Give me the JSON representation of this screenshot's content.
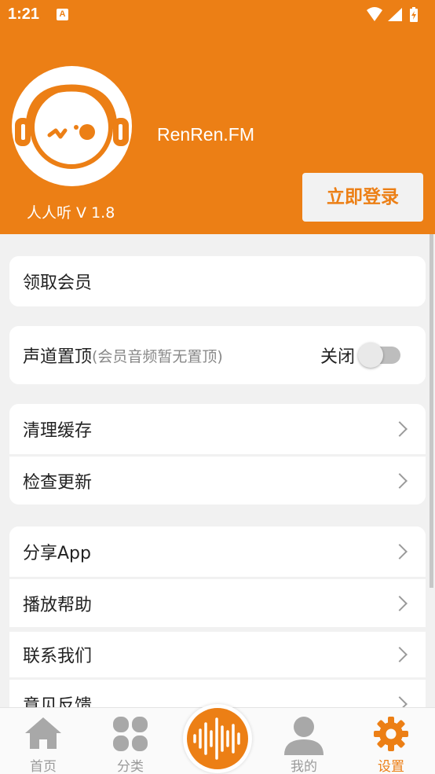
{
  "status": {
    "time": "1:21",
    "notif": "A"
  },
  "header": {
    "app_name": "RenRen.FM",
    "version": "人人听 V 1.8",
    "login_label": "立即登录"
  },
  "settings": {
    "vip": "领取会员",
    "channel_top": "声道置顶",
    "channel_note": "(会员音频暂无置顶)",
    "toggle_state": "关闭",
    "toggle_on": false,
    "clear_cache": "清理缓存",
    "check_update": "检查更新",
    "share_app": "分享App",
    "play_help": "播放帮助",
    "contact_us": "联系我们",
    "feedback": "意见反馈"
  },
  "nav": {
    "home": "首页",
    "category": "分类",
    "mine": "我的",
    "settings": "设置"
  },
  "colors": {
    "accent": "#ec7f15",
    "gray_icon": "#a8a8a8"
  }
}
